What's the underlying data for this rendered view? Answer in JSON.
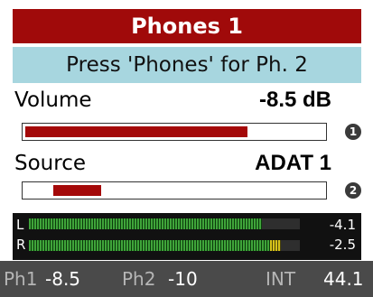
{
  "header": {
    "title": "Phones 1"
  },
  "hint": {
    "text": "Press 'Phones' for Ph. 2"
  },
  "volume": {
    "label": "Volume",
    "value": "-8.5 dB",
    "level": 0.73,
    "encoder": "1"
  },
  "source": {
    "label": "Source",
    "value": "ADAT 1",
    "level_start": 0.1,
    "level_end": 0.26,
    "encoder": "2"
  },
  "meters": [
    {
      "channel": "L",
      "value": "-4.1",
      "level": 0.86,
      "peak_start": 0.86,
      "peak_end": 0.86
    },
    {
      "channel": "R",
      "value": "-2.5",
      "level": 0.89,
      "peak_start": 0.89,
      "peak_end": 0.93
    }
  ],
  "status": {
    "ph1_label": "Ph1",
    "ph1_value": "-8.5",
    "ph2_label": "Ph2",
    "ph2_value": "-10",
    "clock_label": "INT",
    "clock_value": "44.1"
  },
  "colors": {
    "title_bg": "#a00a0a",
    "hint_bg": "#a7d6df",
    "slider_fill": "#a40808",
    "meter_green": "#3fa43a",
    "meter_yellow": "#d7c21a",
    "status_bg": "#4a4a4a"
  }
}
